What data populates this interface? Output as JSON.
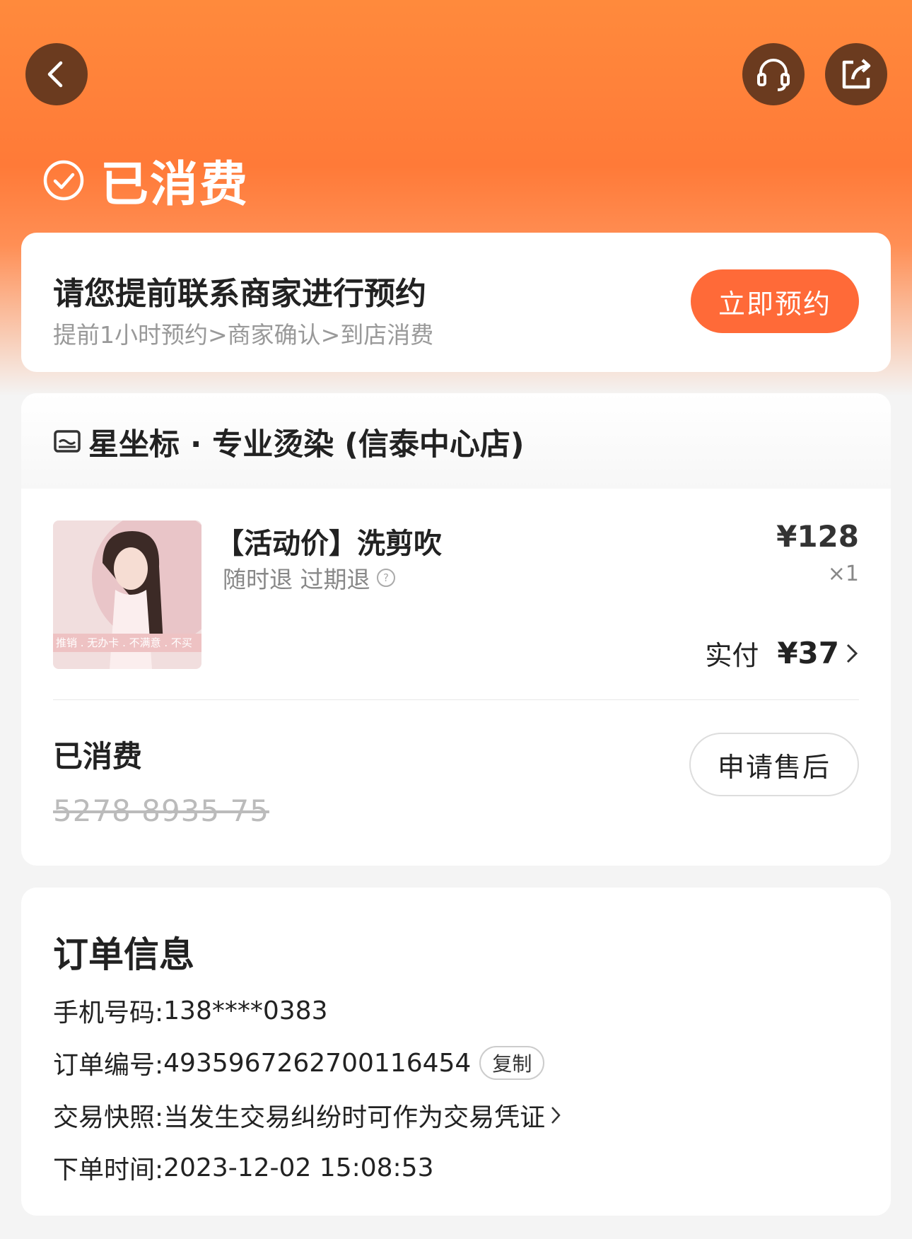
{
  "header": {
    "status_label": "已消费",
    "back_icon": "chevron-left-icon",
    "service_icon": "headset-icon",
    "share_icon": "share-icon"
  },
  "booking": {
    "title": "请您提前联系商家进行预约",
    "subtitle": "提前1小时预约>商家确认>到店消费",
    "button_label": "立即预约"
  },
  "shop": {
    "name": "星坐标 · 专业烫染 (信泰中心店)",
    "icon": "store-icon"
  },
  "product": {
    "title": "【活动价】洗剪吹",
    "tags": "随时退 过期退",
    "price": "¥128",
    "quantity": "×1",
    "paid_label": "实付",
    "paid_amount": "¥37",
    "thumb_caption": "推销 . 无办卡 . 不满意 . 不买"
  },
  "voucher": {
    "status": "已消费",
    "code": "5278 8935 75",
    "after_sale_label": "申请售后"
  },
  "order_info": {
    "title": "订单信息",
    "phone_label": "手机号码:",
    "phone_value": "138****0383",
    "order_no_label": "订单编号:",
    "order_no_value": "4935967262700116454",
    "copy_label": "复制",
    "snapshot_label": "交易快照:",
    "snapshot_value": "当发生交易纠纷时可作为交易凭证",
    "time_label": "下单时间:",
    "time_value": "2023-12-02 15:08:53"
  },
  "colors": {
    "accent": "#ff6a38",
    "hero_top": "#ff8a3c",
    "icon_bg": "#6b3b1f"
  }
}
